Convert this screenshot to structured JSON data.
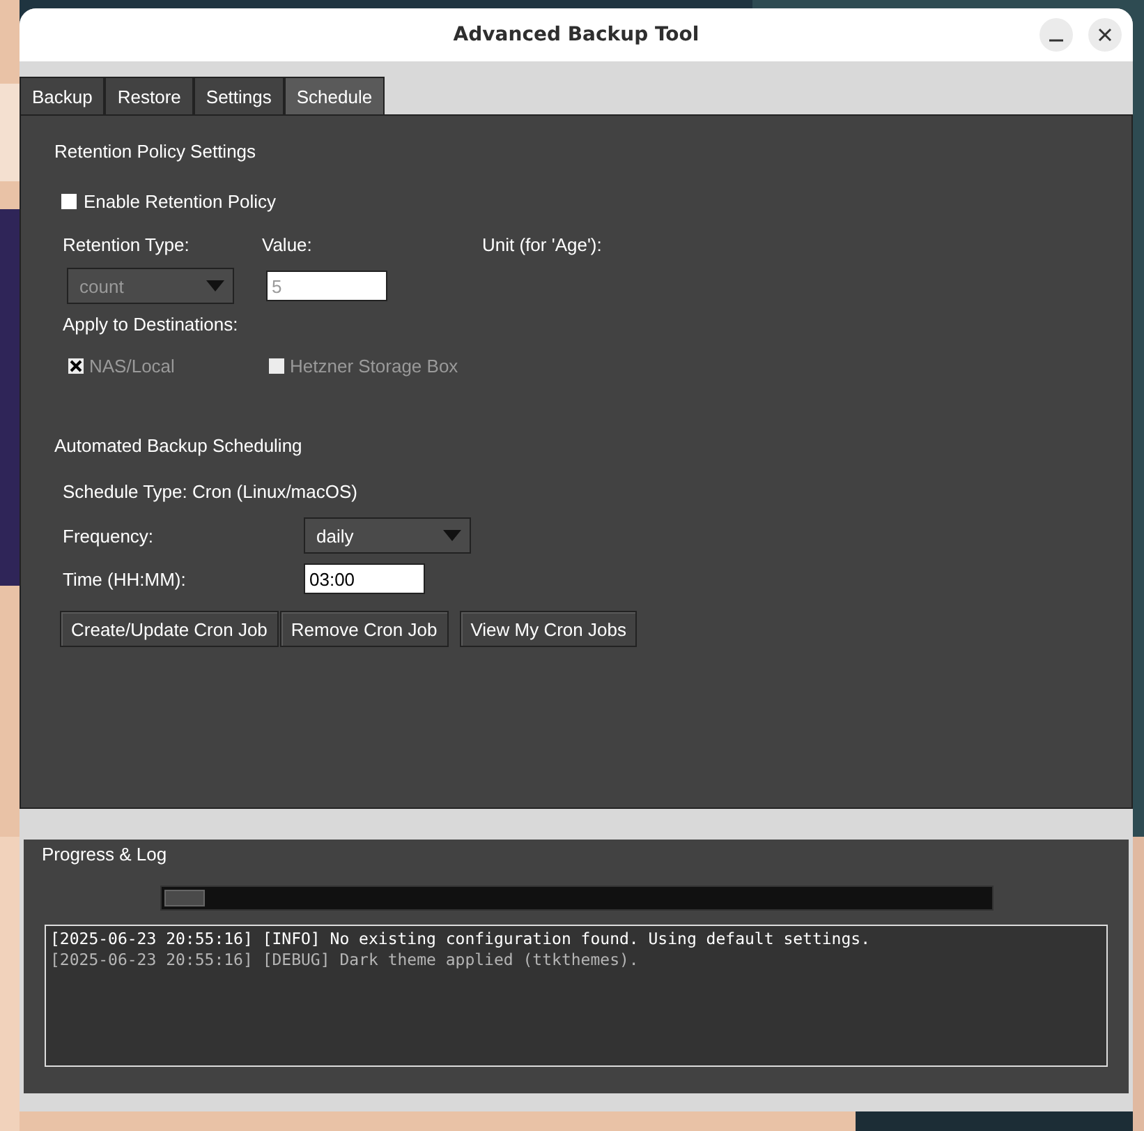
{
  "window": {
    "title": "Advanced Backup Tool"
  },
  "tabs": [
    {
      "label": "Backup",
      "selected": false
    },
    {
      "label": "Restore",
      "selected": false
    },
    {
      "label": "Settings",
      "selected": false
    },
    {
      "label": "Schedule",
      "selected": true
    }
  ],
  "retention": {
    "heading": "Retention Policy Settings",
    "enable": {
      "label": "Enable Retention Policy",
      "checked": false
    },
    "type_label": "Retention Type:",
    "value_label": "Value:",
    "unit_label": "Unit (for 'Age'):",
    "type_select": {
      "value": "count",
      "disabled": true
    },
    "value_field": {
      "value": "5",
      "disabled": true
    },
    "destinations_label": "Apply to Destinations:",
    "destinations": [
      {
        "label": "NAS/Local",
        "checked": true,
        "disabled": true
      },
      {
        "label": "Hetzner Storage Box",
        "checked": false,
        "disabled": true
      }
    ]
  },
  "scheduling": {
    "heading": "Automated Backup Scheduling",
    "schedule_type": "Schedule Type: Cron (Linux/macOS)",
    "frequency_label": "Frequency:",
    "frequency_select": {
      "value": "daily",
      "disabled": false
    },
    "time_label": "Time (HH:MM):",
    "time_field": {
      "value": "03:00"
    },
    "buttons": [
      "Create/Update Cron Job",
      "Remove Cron Job",
      "View My Cron Jobs"
    ]
  },
  "log": {
    "heading": "Progress & Log",
    "progress": {
      "level": 0.05
    },
    "lines": [
      {
        "text": "[2025-06-23 20:55:16] [INFO] No existing configuration found. Using default settings.",
        "kind": "info"
      },
      {
        "text": "[2025-06-23 20:55:16] [DEBUG] Dark theme applied (ttkthemes).",
        "kind": "debug"
      }
    ]
  }
}
